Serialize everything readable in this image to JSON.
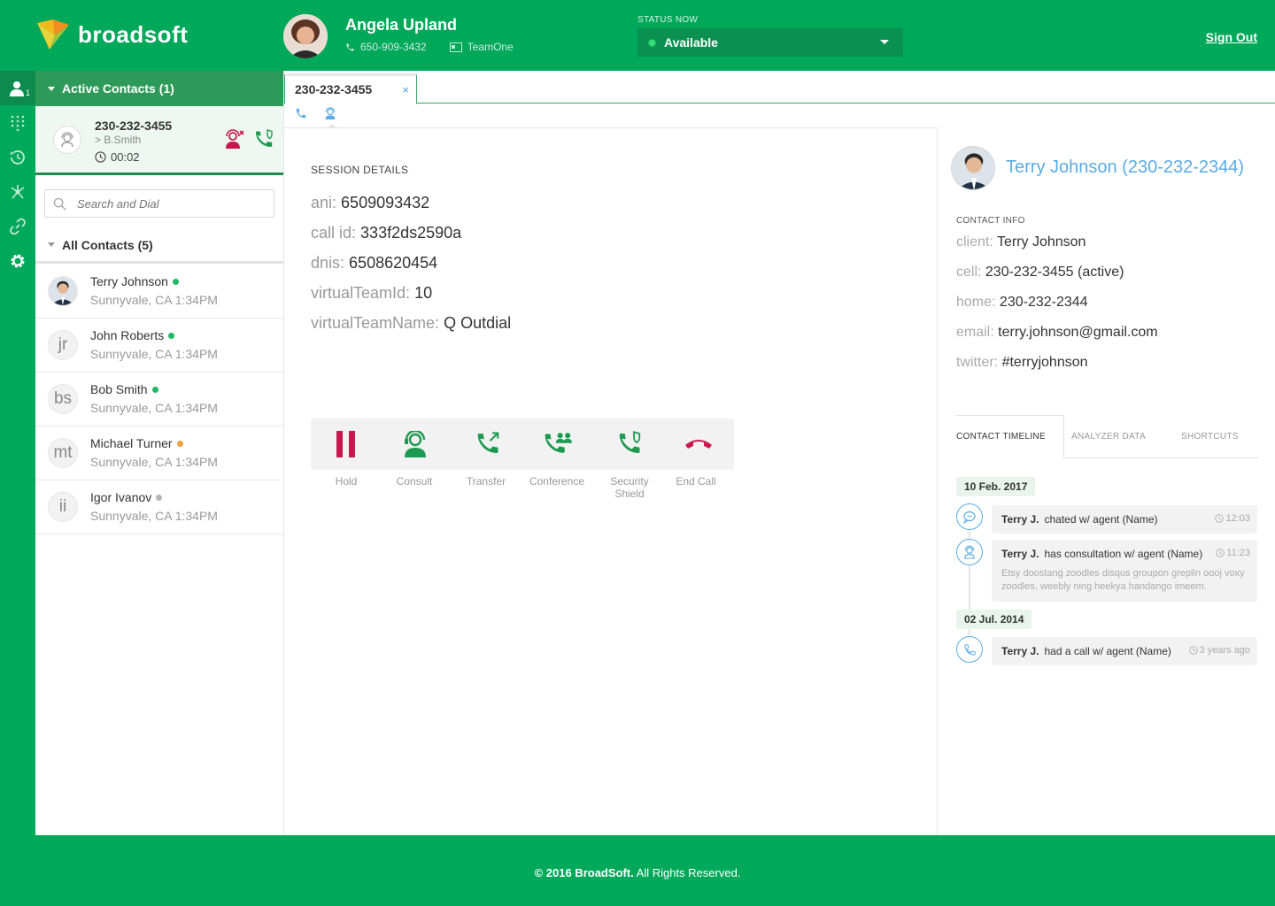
{
  "brand": {
    "name": "broadsoft"
  },
  "agent": {
    "name": "Angela Upland",
    "phone": "650-909-3432",
    "team": "TeamOne"
  },
  "status": {
    "label": "STATUS NOW",
    "value": "Available"
  },
  "header": {
    "sign_out": "Sign Out"
  },
  "leftnav": {
    "badge": "1",
    "items": [
      "contacts-icon",
      "dialpad-icon",
      "history-icon",
      "network-icon",
      "link-icon",
      "gear-icon"
    ]
  },
  "active_contacts": {
    "title": "Active Contacts (1)",
    "card": {
      "number": "230-232-3455",
      "sub": "> B.Smith",
      "timer": "00:02"
    }
  },
  "search": {
    "placeholder": "Search and Dial"
  },
  "all_contacts": {
    "title": "All Contacts (5)",
    "items": [
      {
        "name": "Terry Johnson",
        "initials": "",
        "location": "Sunnyvale, CA 1:34PM",
        "status_color": "#1fb865"
      },
      {
        "name": "John Roberts",
        "initials": "jr",
        "location": "Sunnyvale, CA 1:34PM",
        "status_color": "#1fb865"
      },
      {
        "name": "Bob Smith",
        "initials": "bs",
        "location": "Sunnyvale, CA 1:34PM",
        "status_color": "#1fb865"
      },
      {
        "name": "Michael Turner",
        "initials": "mt",
        "location": "Sunnyvale, CA 1:34PM",
        "status_color": "#f0a040"
      },
      {
        "name": "Igor Ivanov",
        "initials": "ii",
        "location": "Sunnyvale, CA 1:34PM",
        "status_color": "#b5b5b5"
      }
    ]
  },
  "tab": {
    "label": "230-232-3455",
    "close": "×"
  },
  "session": {
    "title": "SESSION DETAILS",
    "rows": [
      {
        "key": "ani:",
        "value": "6509093432"
      },
      {
        "key": "call id:",
        "value": "333f2ds2590a"
      },
      {
        "key": "dnis:",
        "value": "6508620454"
      },
      {
        "key": "virtualTeamId:",
        "value": "10"
      },
      {
        "key": "virtualTeamName:",
        "value": "Q Outdial"
      }
    ]
  },
  "actions": [
    {
      "label": "Hold",
      "icon": "pause-icon"
    },
    {
      "label": "Consult",
      "icon": "consult-icon"
    },
    {
      "label": "Transfer",
      "icon": "transfer-icon"
    },
    {
      "label": "Conference",
      "icon": "conference-icon"
    },
    {
      "label": "Security Shield",
      "icon": "security-shield-icon"
    },
    {
      "label": "End Call",
      "icon": "end-call-icon"
    }
  ],
  "contact": {
    "title": "Terry Johnson (230-232-2344)",
    "info_title": "CONTACT INFO",
    "rows": [
      {
        "key": "client:",
        "value": "Terry Johnson"
      },
      {
        "key": "cell:",
        "value": "230-232-3455 (active)"
      },
      {
        "key": "home:",
        "value": "230-232-2344"
      },
      {
        "key": "email:",
        "value": "terry.johnson@gmail.com"
      },
      {
        "key": "twitter:",
        "value": "#terryjohnson"
      }
    ]
  },
  "right_tabs": [
    "CONTACT TIMELINE",
    "ANALYZER DATA",
    "SHORTCUTS"
  ],
  "timeline": {
    "dates": [
      "10 Feb. 2017",
      "02 Jul. 2014"
    ],
    "events": [
      {
        "who": "Terry J.",
        "what": "chated w/ agent (Name)",
        "when": "12:03",
        "icon": "chat-icon",
        "desc": ""
      },
      {
        "who": "Terry J.",
        "what": "has consultation w/ agent (Name)",
        "when": "11:23",
        "icon": "consult-icon",
        "desc": "Etsy doostang zoodles disqus groupon greplin oooj voxy zoodles, weebly ning heekya handango imeem."
      },
      {
        "who": "Terry J.",
        "what": "had a call w/ agent (Name)",
        "when": "3 years ago",
        "icon": "phone-icon",
        "desc": ""
      }
    ]
  },
  "footer": {
    "bold": "© 2016 BroadSoft.",
    "rest": " All Rights Reserved."
  },
  "colors": {
    "brand_green": "#00a85a",
    "accent_blue": "#5aabe6",
    "hold_red": "#c8184f"
  }
}
